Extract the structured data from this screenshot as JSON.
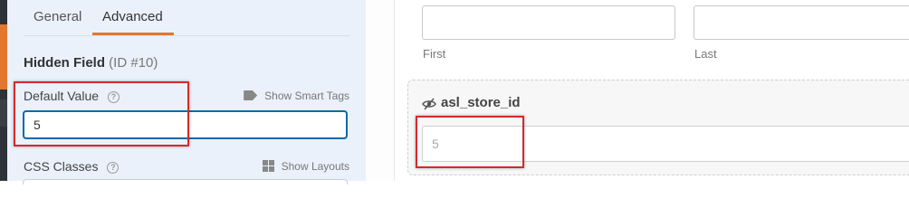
{
  "tabs": {
    "general": "General",
    "advanced": "Advanced"
  },
  "field": {
    "title": "Hidden Field",
    "id_label": "(ID #10)"
  },
  "default_value": {
    "label": "Default Value",
    "help_icon": "?",
    "smart_tags_link": "Show Smart Tags",
    "value": "5"
  },
  "css_classes": {
    "label": "CSS Classes",
    "help_icon": "?",
    "layouts_link": "Show Layouts"
  },
  "preview": {
    "name_sublabels": {
      "first": "First",
      "last": "Last"
    },
    "hidden_field_label": "asl_store_id",
    "hidden_field_value": "5"
  },
  "colors": {
    "accent": "#e27730",
    "focus_border": "#056aab",
    "highlight": "#d22b2b",
    "panel_bg": "#eaf1fb"
  },
  "icons": [
    "help-icon",
    "tag-icon",
    "grid-icon",
    "eye-slash-icon"
  ]
}
